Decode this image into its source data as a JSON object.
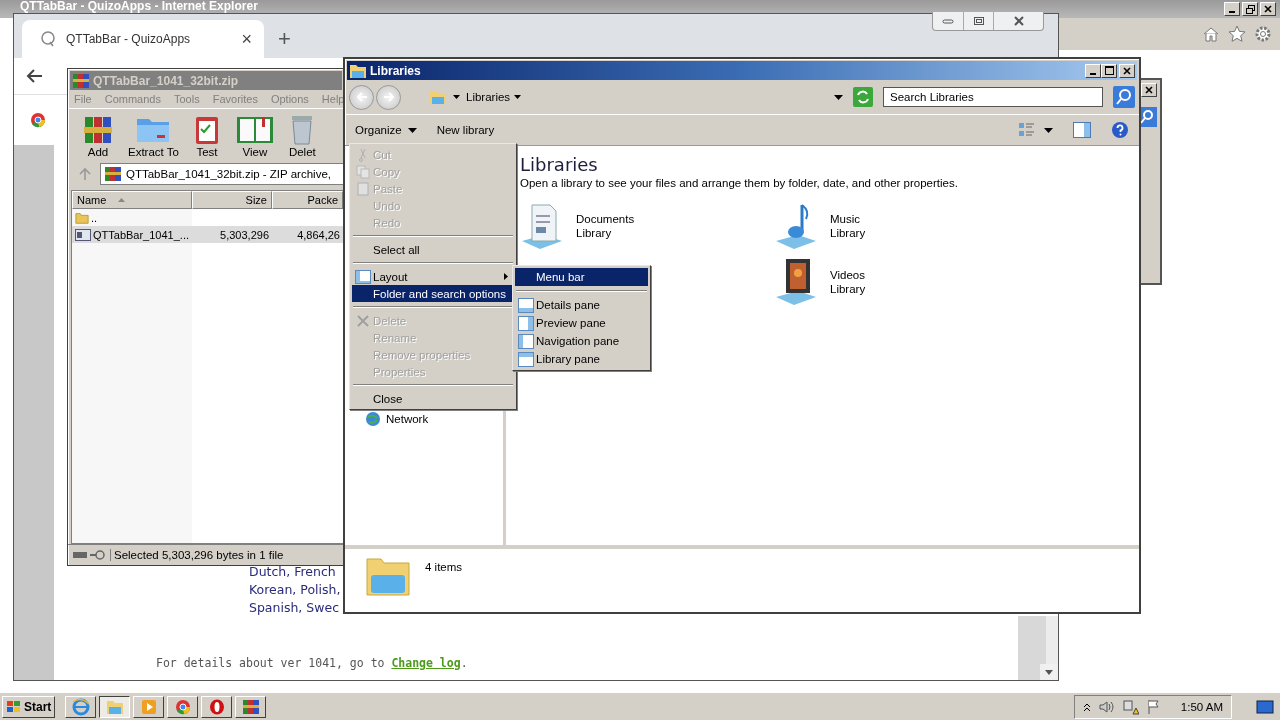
{
  "ie_window": {
    "title": "QTTabBar - QuizoApps - Internet Explorer"
  },
  "browser": {
    "tab": {
      "title": "QTTabBar - QuizoApps",
      "close": "×"
    },
    "new_tab": "+",
    "page": {
      "lines": [
        "Dutch, French",
        "Korean, Polish,",
        "Spanish, Swec"
      ],
      "footer": {
        "text": "For details about ver 1041, go to ",
        "link": "Change log",
        "end": "."
      }
    }
  },
  "winrar": {
    "title": "QTTabBar_1041_32bit.zip",
    "menu": [
      "File",
      "Commands",
      "Tools",
      "Favorites",
      "Options",
      "Help"
    ],
    "toolbar": [
      {
        "label": "Add",
        "kind": "add"
      },
      {
        "label": "Extract To",
        "kind": "extract"
      },
      {
        "label": "Test",
        "kind": "test"
      },
      {
        "label": "View",
        "kind": "view"
      },
      {
        "label": "Delet",
        "kind": "delete"
      }
    ],
    "path": "QTTabBar_1041_32bit.zip - ZIP archive,",
    "columns": [
      "Name",
      "Size",
      "Packe"
    ],
    "rows": [
      {
        "kind": "folder",
        "name": "..",
        "selected": false
      },
      {
        "kind": "file",
        "name": "QTTabBar_1041_...",
        "size": "5,303,296",
        "packed": "4,864,26",
        "selected": true
      }
    ],
    "status": "Selected 5,303,296 bytes in 1 file"
  },
  "explorer": {
    "title": "Libraries",
    "breadcrumb": "Libraries",
    "search": {
      "placeholder": "Search Libraries"
    },
    "toolbar": [
      "Organize",
      "New library"
    ],
    "nav": [
      {
        "label": "Network"
      }
    ],
    "heading": "Libraries",
    "description": "Open a library to see your files and arrange them by folder, date, and other properties.",
    "libraries": [
      {
        "kind": "documents",
        "name": "Documents",
        "sub": "Library"
      },
      {
        "kind": "music",
        "name": "Music",
        "sub": "Library"
      },
      {
        "kind": "videos",
        "name": "Videos",
        "sub": "Library"
      }
    ],
    "details": "4 items"
  },
  "organize_menu": {
    "items": [
      {
        "kind": "item",
        "label": "Cut",
        "disabled": true,
        "selected": false
      },
      {
        "kind": "item",
        "label": "Copy",
        "disabled": true,
        "selected": false
      },
      {
        "kind": "item",
        "label": "Paste",
        "disabled": true,
        "selected": false
      },
      {
        "kind": "item",
        "label": "Undo",
        "disabled": true,
        "selected": false
      },
      {
        "kind": "item",
        "label": "Redo",
        "disabled": true,
        "selected": false
      },
      {
        "kind": "separator"
      },
      {
        "kind": "item",
        "label": "Select all",
        "disabled": false,
        "selected": false
      },
      {
        "kind": "separator"
      },
      {
        "kind": "submenu",
        "label": "Layout",
        "disabled": false,
        "selected": false
      },
      {
        "kind": "item",
        "label": "Folder and search options",
        "disabled": false,
        "selected": true
      },
      {
        "kind": "separator"
      },
      {
        "kind": "item",
        "label": "Delete",
        "disabled": true,
        "selected": false
      },
      {
        "kind": "item",
        "label": "Rename",
        "disabled": true,
        "selected": false
      },
      {
        "kind": "item",
        "label": "Remove properties",
        "disabled": true,
        "selected": false
      },
      {
        "kind": "item",
        "label": "Properties",
        "disabled": true,
        "selected": false
      },
      {
        "kind": "separator"
      },
      {
        "kind": "item",
        "label": "Close",
        "disabled": false,
        "selected": false
      }
    ]
  },
  "layout_menu": {
    "items": [
      {
        "kind": "item",
        "label": "Menu bar",
        "selected": true
      },
      {
        "kind": "separator"
      },
      {
        "kind": "item",
        "label": "Details pane",
        "selected": false
      },
      {
        "kind": "item",
        "label": "Preview pane",
        "selected": false
      },
      {
        "kind": "item",
        "label": "Navigation pane",
        "selected": false
      },
      {
        "kind": "item",
        "label": "Library pane",
        "selected": false
      }
    ]
  },
  "taskbar": {
    "start": "Start",
    "apps": [
      {
        "kind": "ie",
        "selected": false
      },
      {
        "kind": "explorer",
        "selected": true
      },
      {
        "kind": "media",
        "selected": false
      },
      {
        "kind": "chrome",
        "selected": false
      },
      {
        "kind": "opera",
        "selected": false
      },
      {
        "kind": "winrar",
        "selected": false
      }
    ],
    "clock": "1:50 AM"
  }
}
